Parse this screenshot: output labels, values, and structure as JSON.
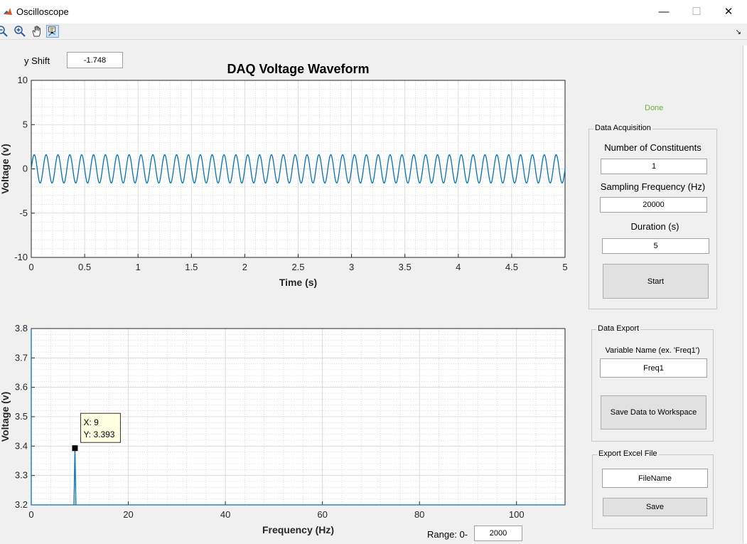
{
  "window": {
    "title": "Oscilloscope",
    "minimize_glyph": "—",
    "maximize_glyph": "☐",
    "close_glyph": "✕"
  },
  "toolbar": {
    "tools": [
      "zoom-out-icon",
      "zoom-in-icon",
      "pan-icon",
      "data-cursor-icon"
    ],
    "active_tool": "data-cursor-icon",
    "dock_glyph": "↘"
  },
  "y_shift": {
    "label": "y Shift",
    "value": "-1.748"
  },
  "status": {
    "text": "Done",
    "color": "#6fac3a"
  },
  "data_acquisition": {
    "title": "Data Acquisition",
    "constituents_label": "Number of Constituents",
    "constituents_value": "1",
    "sampling_label": "Sampling Frequency (Hz)",
    "sampling_value": "20000",
    "duration_label": "Duration (s)",
    "duration_value": "5",
    "start_label": "Start"
  },
  "data_export": {
    "title": "Data Export",
    "variable_label": "Variable Name (ex. 'Freq1')",
    "variable_value": "Freq1",
    "save_label": "Save Data to Workspace"
  },
  "excel_export": {
    "title": "Export Excel File",
    "filename_value": "FileName",
    "save_label": "Save"
  },
  "range": {
    "label": "Range:  0-",
    "value": "2000"
  },
  "chart_data": [
    {
      "type": "line",
      "title": "DAQ Voltage Waveform",
      "xlabel": "Time (s)",
      "ylabel": "Voltage (v)",
      "xlim": [
        0,
        5
      ],
      "ylim": [
        -10,
        10
      ],
      "xticks": [
        "0",
        "0.5",
        "1",
        "1.5",
        "2",
        "2.5",
        "3",
        "3.5",
        "4",
        "4.5",
        "5"
      ],
      "yticks": [
        "10",
        "5",
        "0",
        "-5",
        "-10"
      ],
      "grid": true,
      "minor_grid": true,
      "series": [
        {
          "kind": "sine",
          "frequency_hz": 9,
          "amplitude": 1.6,
          "offset": 0,
          "color": "#0072bd"
        }
      ]
    },
    {
      "type": "line",
      "title": "",
      "xlabel": "Frequency (Hz)",
      "ylabel": "Voltage (v)",
      "xlim": [
        0,
        110
      ],
      "ylim": [
        3.2,
        3.8
      ],
      "xticks": [
        "0",
        "20",
        "40",
        "60",
        "80",
        "100"
      ],
      "yticks": [
        "3.8",
        "3.7",
        "3.6",
        "3.5",
        "3.4",
        "3.3",
        "3.2"
      ],
      "grid": true,
      "minor_grid": true,
      "series": [
        {
          "x": [
            0,
            0,
            0.2,
            8.8,
            9,
            9.2,
            110
          ],
          "y": [
            3.8,
            3.2,
            3.2,
            3.2,
            3.393,
            3.2,
            3.2
          ],
          "color": "#0072bd"
        }
      ],
      "datatip": {
        "x": 9,
        "y": 3.393,
        "x_text": "X: 9",
        "y_text": "Y: 3.393"
      }
    }
  ]
}
